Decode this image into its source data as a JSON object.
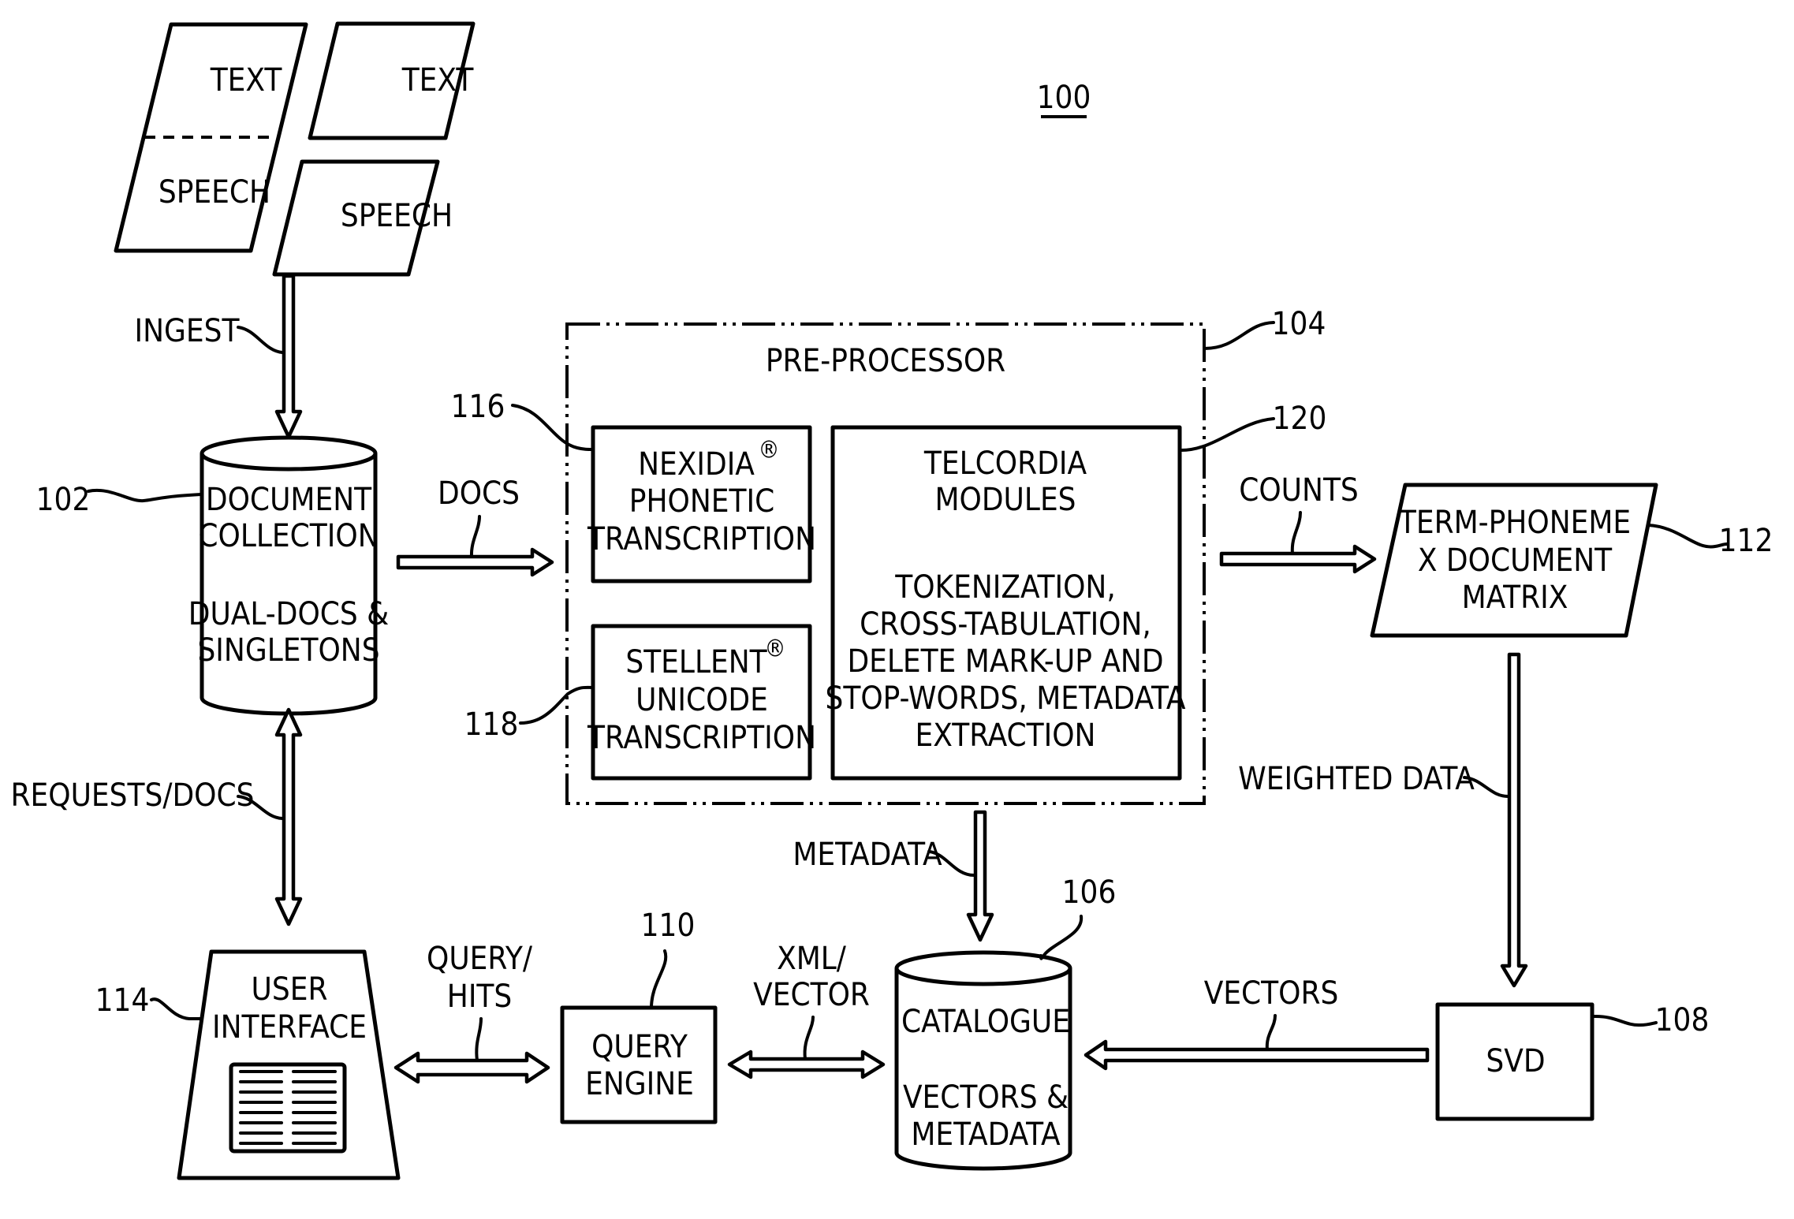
{
  "figure": {
    "ref": "100"
  },
  "sources": {
    "dual_doc": {
      "top": "TEXT",
      "bottom": "SPEECH"
    },
    "text_doc": {
      "label": "TEXT"
    },
    "speech_doc": {
      "label": "SPEECH"
    }
  },
  "flows": {
    "ingest": "INGEST",
    "docs": "DOCS",
    "requests_docs": "REQUESTS/DOCS",
    "counts": "COUNTS",
    "weighted_data": "WEIGHTED DATA",
    "metadata": "METADATA",
    "vectors": "VECTORS",
    "query_hits": [
      "QUERY/",
      "HITS"
    ],
    "xml_vector": [
      "XML/",
      "VECTOR"
    ]
  },
  "components": {
    "document_collection": {
      "ref": "102",
      "lines": [
        "DOCUMENT",
        "COLLECTION",
        "",
        "DUAL-DOCS &",
        "SINGLETONS"
      ]
    },
    "pre_processor": {
      "ref": "104",
      "title": "PRE-PROCESSOR"
    },
    "nexidia": {
      "ref": "116",
      "lines": [
        "NEXIDIA",
        "PHONETIC",
        "TRANSCRIPTION"
      ],
      "trademark": "®"
    },
    "stellent": {
      "ref": "118",
      "lines": [
        "STELLENT",
        "UNICODE",
        "TRANSCRIPTION"
      ],
      "trademark": "®"
    },
    "telcordia": {
      "ref": "120",
      "lines": [
        "TELCORDIA",
        "MODULES",
        "",
        "TOKENIZATION,",
        "CROSS-TABULATION,",
        "DELETE MARK-UP AND",
        "STOP-WORDS, METADATA",
        "EXTRACTION"
      ]
    },
    "term_matrix": {
      "ref": "112",
      "lines": [
        "TERM-PHONEME",
        "X DOCUMENT",
        "MATRIX"
      ]
    },
    "svd": {
      "ref": "108",
      "label": "SVD"
    },
    "catalogue": {
      "ref": "106",
      "lines": [
        "CATALOGUE",
        "",
        "VECTORS &",
        "METADATA"
      ]
    },
    "query_engine": {
      "ref": "110",
      "lines": [
        "QUERY",
        "ENGINE"
      ]
    },
    "user_interface": {
      "ref": "114",
      "lines": [
        "USER",
        "INTERFACE"
      ]
    }
  }
}
